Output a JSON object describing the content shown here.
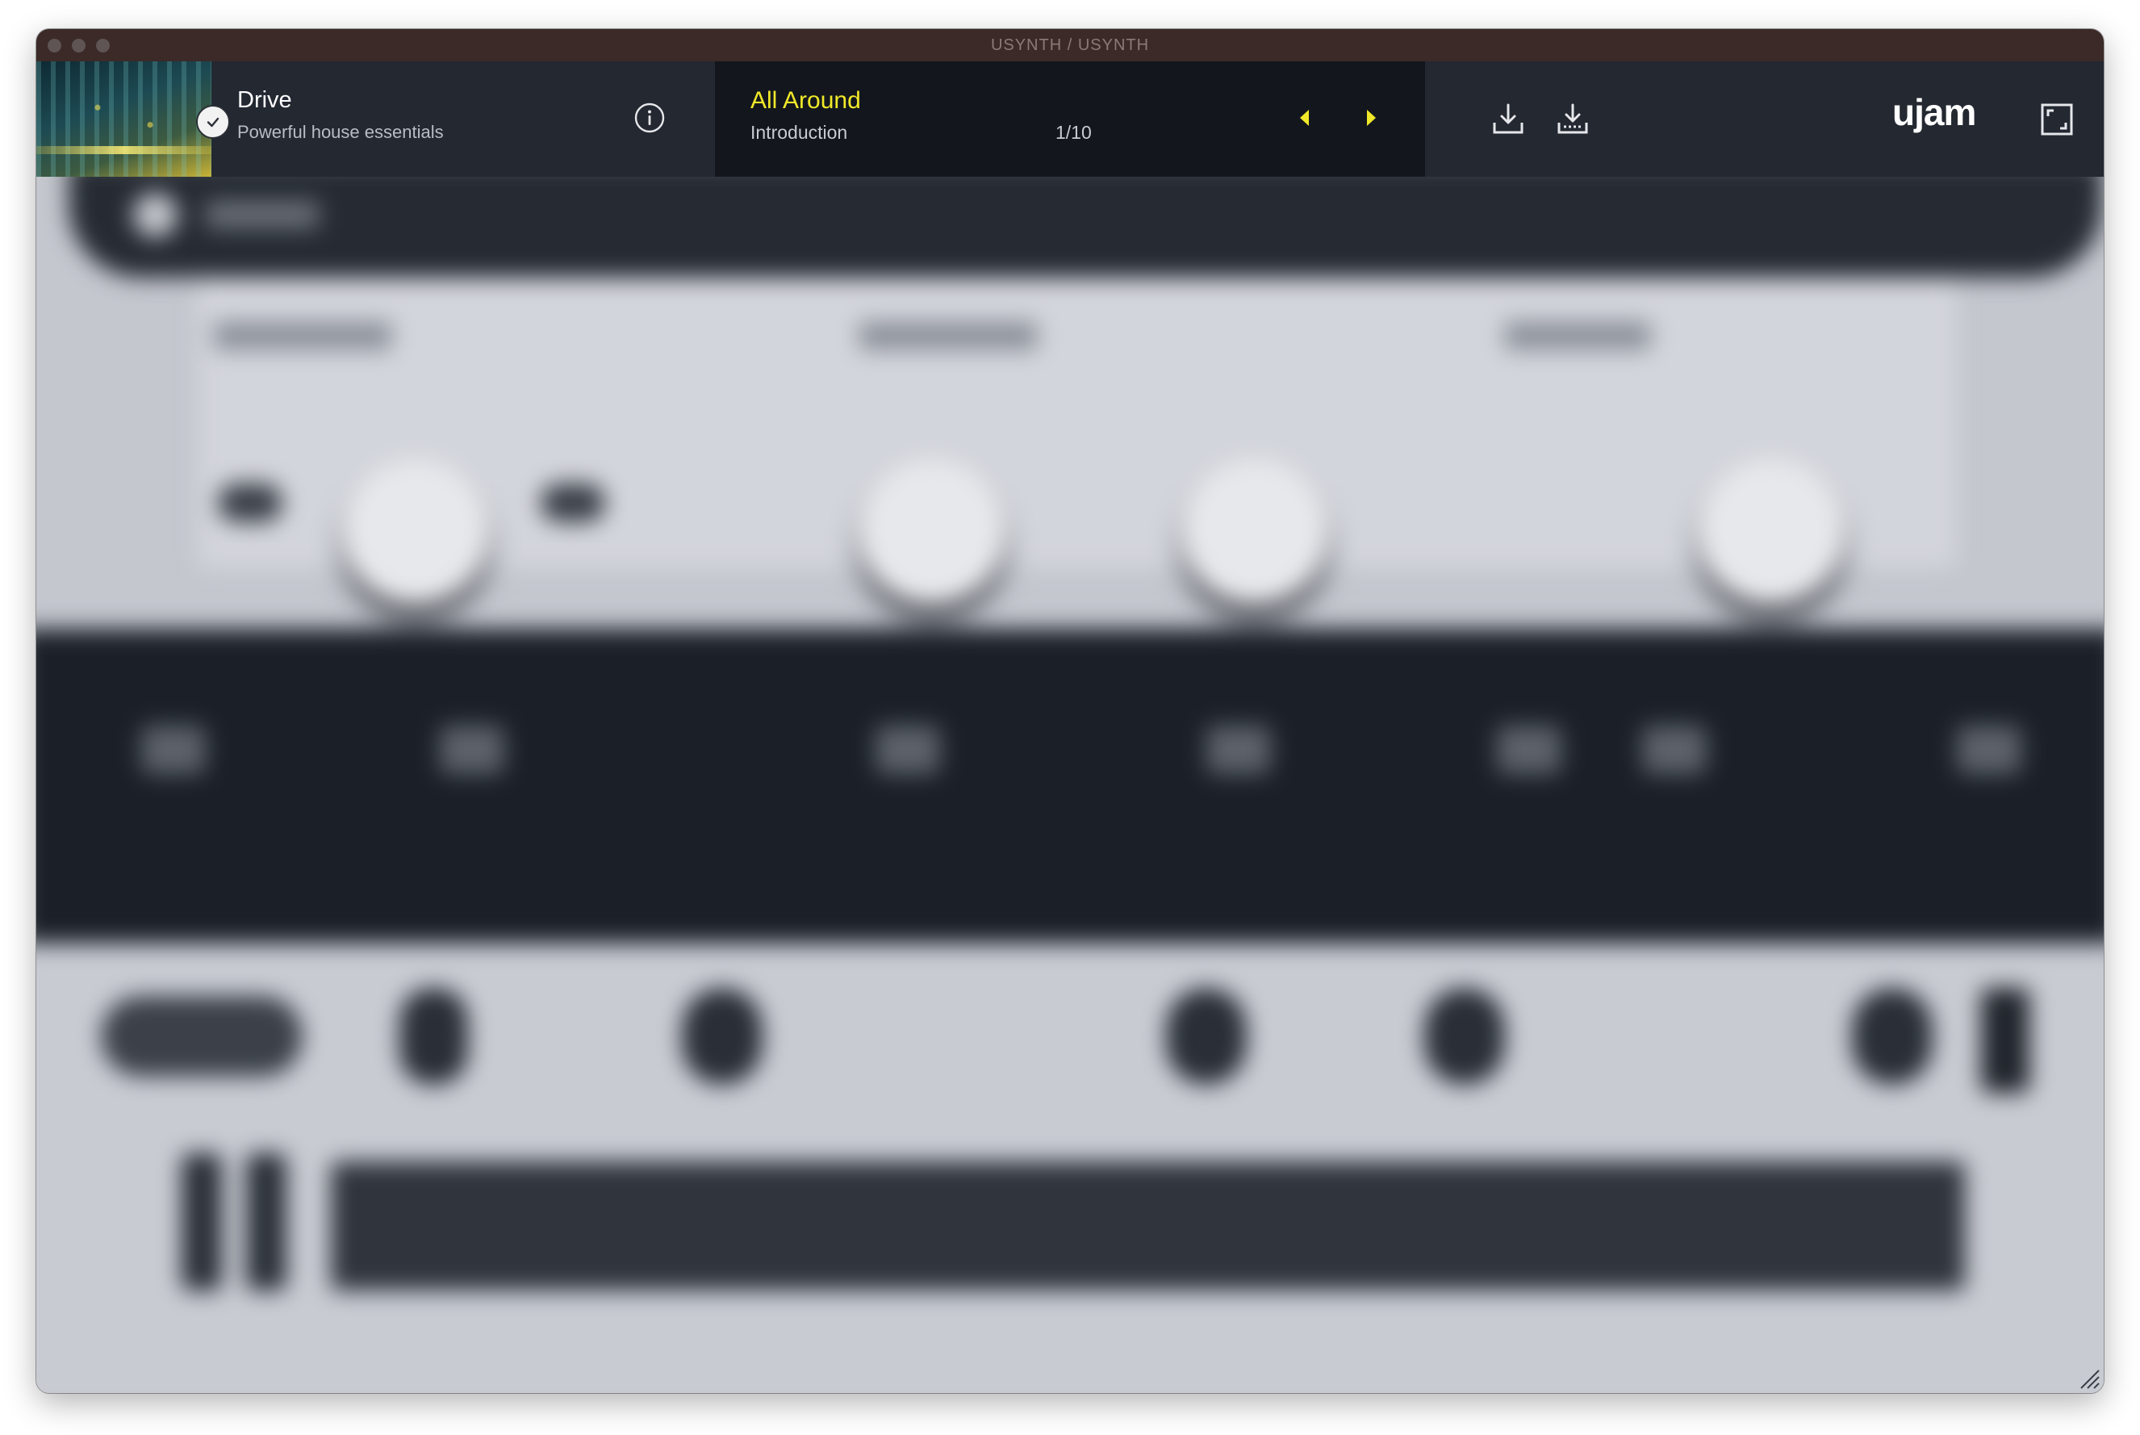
{
  "window": {
    "title": "USYNTH / USYNTH"
  },
  "preset": {
    "name": "Drive",
    "description": "Powerful house essentials"
  },
  "style": {
    "name": "All Around",
    "subtitle": "Introduction",
    "counter": "1/10"
  },
  "brand": {
    "logo": "ujam"
  },
  "colors": {
    "accent": "#f1e829",
    "header_bg": "#232831",
    "center_bg": "#13171d",
    "titlebar_bg": "#3b2a28"
  },
  "icons": [
    "check-icon",
    "info-icon",
    "arrow-left-icon",
    "arrow-right-icon",
    "import-icon",
    "export-icon",
    "fullscreen-icon",
    "resize-grip-icon"
  ]
}
